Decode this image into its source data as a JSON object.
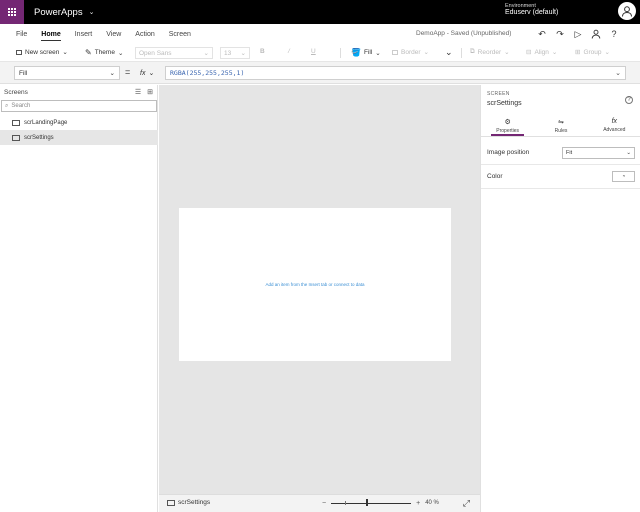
{
  "app": {
    "name": "PowerApps",
    "environment_label": "Environment",
    "environment_name": "Eduserv (default)"
  },
  "menu": {
    "items": [
      "File",
      "Home",
      "Insert",
      "View",
      "Action",
      "Screen"
    ],
    "active": "Home",
    "save_status": "DemoApp - Saved (Unpublished)"
  },
  "ribbon": {
    "new_screen": "New screen",
    "theme": "Theme",
    "font": "Open Sans",
    "font_size": "13",
    "bold": "B",
    "italic": "/",
    "underline": "U",
    "fill": "Fill",
    "border": "Border",
    "reorder": "Reorder",
    "align": "Align",
    "group": "Group"
  },
  "formula_bar": {
    "property": "Fill",
    "equals": "=",
    "fx": "fx",
    "formula": "RGBA(255,255,255,1)"
  },
  "left_panel": {
    "title": "Screens",
    "search_placeholder": "Search",
    "screens": [
      {
        "name": "scrLandingPage",
        "selected": false
      },
      {
        "name": "scrSettings",
        "selected": true
      }
    ]
  },
  "canvas": {
    "hint": "Add an item from the Insert tab or connect to data"
  },
  "status_bar": {
    "screen": "scrSettings",
    "zoom_minus": "−",
    "zoom_plus": "+",
    "zoom_value": "40 %"
  },
  "right_panel": {
    "type": "SCREEN",
    "name": "scrSettings",
    "help": "?",
    "tabs": [
      {
        "label": "Properties",
        "active": true
      },
      {
        "label": "Rules",
        "active": false
      },
      {
        "label": "Advanced",
        "active": false
      }
    ],
    "image_position_label": "Image position",
    "image_position_value": "Fit",
    "color_label": "Color"
  },
  "colors": {
    "brand": "#742774",
    "topbar": "#000000",
    "hint_text": "#3b8fd4",
    "formula_text": "#3b66b0"
  }
}
